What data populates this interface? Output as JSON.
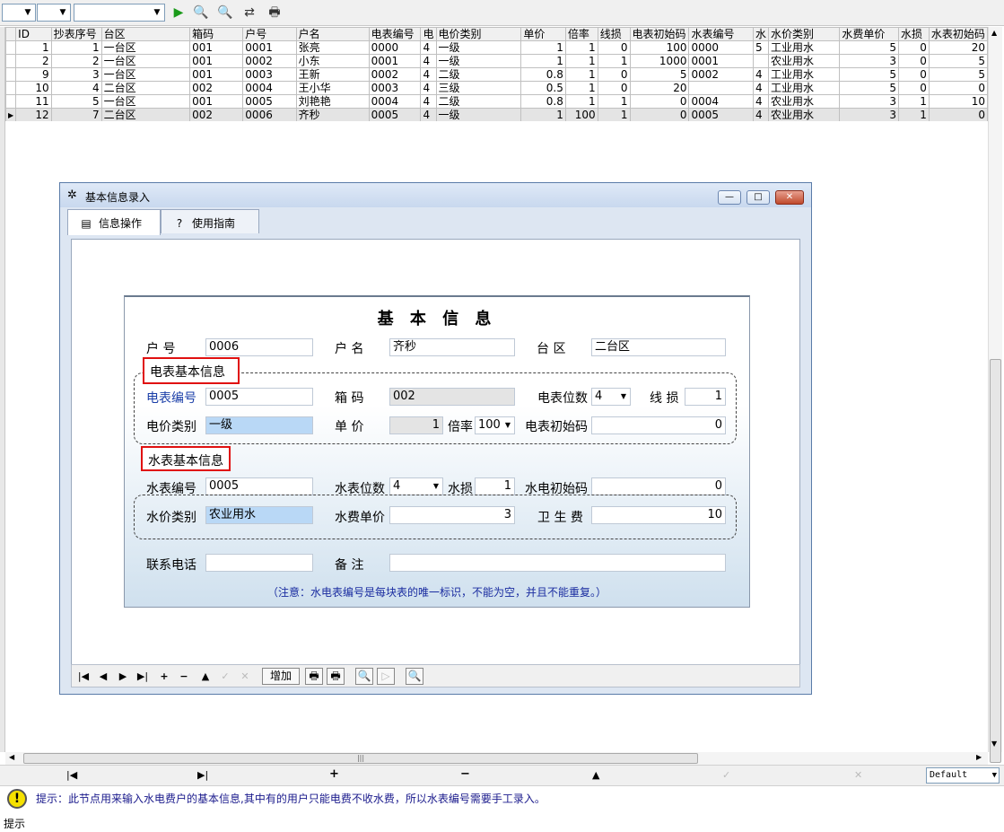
{
  "toolbar": {
    "icons": [
      "play-icon",
      "search-icon",
      "search-icon",
      "refresh-icon",
      "print-icon"
    ]
  },
  "grid": {
    "headers": [
      "ID",
      "抄表序号",
      "台区",
      "箱码",
      "户号",
      "户名",
      "电表编号",
      "电",
      "电价类别",
      "单价",
      "倍率",
      "线损",
      "电表初始码",
      "水表编号",
      "水",
      "水价类别",
      "水费单价",
      "水损",
      "水表初始码"
    ],
    "rows": [
      [
        "1",
        "1",
        "一台区",
        "001",
        "0001",
        "张亮",
        "0000",
        "4",
        "一级",
        "1",
        "1",
        "0",
        "100",
        "0000",
        "5",
        "工业用水",
        "5",
        "0",
        "20"
      ],
      [
        "2",
        "2",
        "一台区",
        "001",
        "0002",
        "小东",
        "0001",
        "4",
        "一级",
        "1",
        "1",
        "1",
        "1000",
        "0001",
        "",
        "农业用水",
        "3",
        "0",
        "5"
      ],
      [
        "9",
        "3",
        "一台区",
        "001",
        "0003",
        "王新",
        "0002",
        "4",
        "二级",
        "0.8",
        "1",
        "0",
        "5",
        "0002",
        "4",
        "工业用水",
        "5",
        "0",
        "5"
      ],
      [
        "10",
        "4",
        "二台区",
        "002",
        "0004",
        "王小华",
        "0003",
        "4",
        "三级",
        "0.5",
        "1",
        "0",
        "20",
        "",
        "4",
        "工业用水",
        "5",
        "0",
        "0"
      ],
      [
        "11",
        "5",
        "一台区",
        "001",
        "0005",
        "刘艳艳",
        "0004",
        "4",
        "二级",
        "0.8",
        "1",
        "1",
        "0",
        "0004",
        "4",
        "农业用水",
        "3",
        "1",
        "10"
      ],
      [
        "12",
        "7",
        "二台区",
        "002",
        "0006",
        "齐秒",
        "0005",
        "4",
        "一级",
        "1",
        "100",
        "1",
        "0",
        "0005",
        "4",
        "农业用水",
        "3",
        "1",
        "0"
      ]
    ]
  },
  "bottom_nav": {
    "default_label": "Default"
  },
  "hint": {
    "icon_label": "提示",
    "message": "提示：此节点用来输入水电费户的基本信息,其中有的用户只能电费不收水费，所以水表编号需要手工录入。"
  },
  "dialog": {
    "title": "基本信息录入",
    "tabs": [
      {
        "label": "信息操作",
        "icon": "book-icon"
      },
      {
        "label": "使用指南",
        "icon": "help-icon"
      }
    ],
    "form": {
      "title": "基 本 信 息",
      "household_no_label": "户    号",
      "household_no": "0006",
      "name_label": "户    名",
      "name": "齐秒",
      "district_label": "台    区",
      "district": "二台区",
      "meter_group_label": "电表基本信息",
      "meter_no_label": "电表编号",
      "meter_no": "0005",
      "box_code_label": "箱    码",
      "box_code": "002",
      "meter_digits_label": "电表位数",
      "meter_digits": "4",
      "line_loss_label": "线 损",
      "line_loss": "1",
      "price_category_label": "电价类别",
      "price_category": "一级",
      "unit_price_label": "单    价",
      "unit_price": "1",
      "multiplier_label": "倍率",
      "multiplier": "100",
      "meter_initial_label": "电表初始码",
      "meter_initial": "0",
      "water_group_label": "水表基本信息",
      "water_no_label": "水表编号",
      "water_no": "0005",
      "water_digits_label": "水表位数",
      "water_digits": "4",
      "water_loss_label": "水损",
      "water_loss": "1",
      "water_initial_label": "水电初始码",
      "water_initial": "0",
      "water_category_label": "水价类别",
      "water_category": "农业用水",
      "water_price_label": "水费单价",
      "water_price": "3",
      "sanitation_label": "卫 生 费",
      "sanitation": "10",
      "phone_label": "联系电话",
      "phone": "",
      "remark_label": "备    注",
      "remark": "",
      "note": "（注意：水电表编号是每块表的唯一标识，不能为空，并且不能重复。）"
    },
    "nav": {
      "add_label": "增加"
    }
  }
}
